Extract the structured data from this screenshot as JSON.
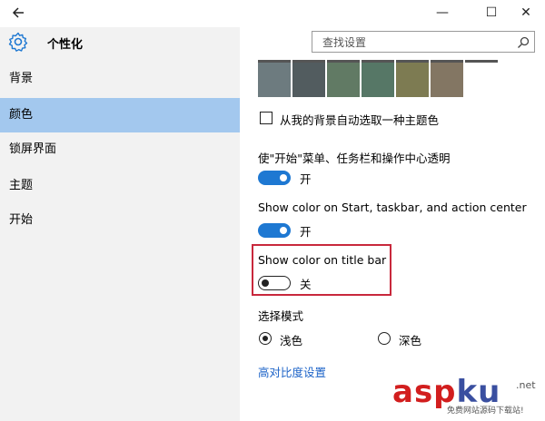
{
  "window": {
    "back_icon": "back-arrow-icon",
    "minimize_glyph": "—",
    "maximize_glyph": "☐",
    "close_glyph": "✕"
  },
  "sidebar": {
    "title": "个性化",
    "icon": "gear-icon",
    "items": [
      {
        "label": "背景",
        "active": false
      },
      {
        "label": "颜色",
        "active": true
      },
      {
        "label": "锁屏界面",
        "active": false
      },
      {
        "label": "主题",
        "active": false
      },
      {
        "label": "开始",
        "active": false
      }
    ],
    "active_color": "#a3c8ee"
  },
  "search": {
    "placeholder": "查找设置",
    "icon": "search-icon"
  },
  "colors": {
    "swatches": [
      "#6d7b7f",
      "#525c5f",
      "#617a64",
      "#567766",
      "#7d7b52",
      "#837663"
    ],
    "accent": "#1e78d2"
  },
  "settings": {
    "auto_color_label": "从我的背景自动选取一种主题色",
    "auto_color_checked": false,
    "transparency_label": "使\"开始\"菜单、任务栏和操作中心透明",
    "transparency_state": "开",
    "start_color_label": "Show color on Start, taskbar, and action center",
    "start_color_state": "开",
    "title_bar_label": "Show color on title bar",
    "title_bar_state": "关",
    "mode_label": "选择模式",
    "mode_light": "浅色",
    "mode_dark": "深色",
    "mode_selected": "light",
    "high_contrast_link": "高对比度设置"
  },
  "watermark": {
    "asp": "asp",
    "ku": "ku",
    "net": ".net",
    "sub": "免费网站源码下载站!"
  }
}
